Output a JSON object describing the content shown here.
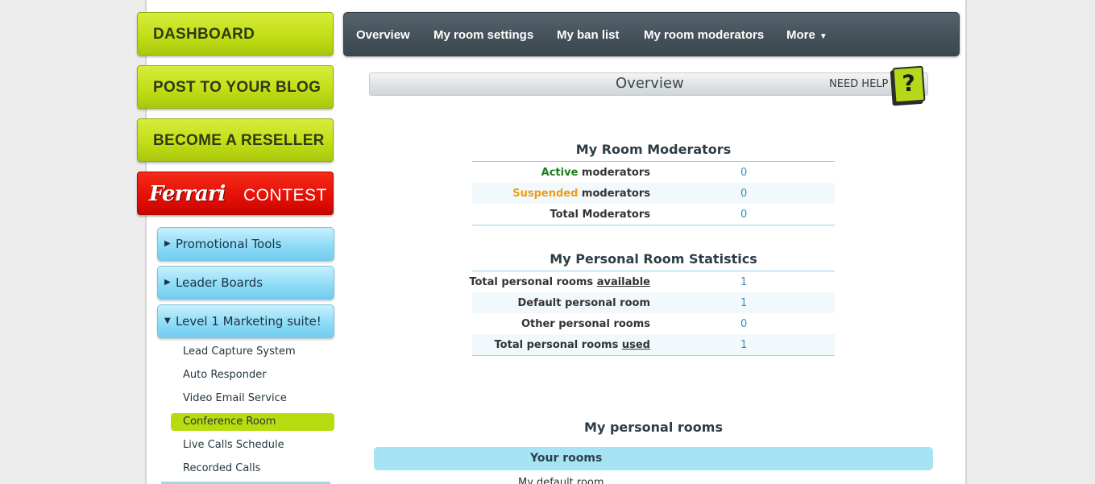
{
  "sidebar": {
    "dashboard_label": "DASHBOARD",
    "blog_label": "POST TO YOUR BLOG",
    "reseller_label": "BECOME A RESELLER",
    "ferrari_logo": "Ferrari",
    "contest_label": "CONTEST",
    "accordion": [
      {
        "label": "Promotional Tools",
        "expanded": false
      },
      {
        "label": "Leader Boards",
        "expanded": false
      },
      {
        "label": "Level 1 Marketing suite!",
        "expanded": true
      }
    ],
    "sub_items": [
      {
        "label": "Lead Capture System"
      },
      {
        "label": "Auto Responder"
      },
      {
        "label": "Video Email Service"
      },
      {
        "label": "Conference Room",
        "active": true
      },
      {
        "label": "Live Calls Schedule"
      },
      {
        "label": "Recorded Calls"
      }
    ]
  },
  "nav": {
    "items": [
      "Overview",
      "My room settings",
      "My ban list",
      "My room moderators",
      "More"
    ],
    "more_caret": "▼"
  },
  "overview": {
    "title": "Overview",
    "need_help": "NEED HELP",
    "help_icon": "?"
  },
  "moderators": {
    "title": "My Room Moderators",
    "active_word": "Active",
    "suspended_word": "Suspended",
    "moderators_word": "moderators",
    "active_value": "0",
    "suspended_value": "0",
    "total_label": "Total Moderators",
    "total_value": "0"
  },
  "stats": {
    "title": "My Personal Room Statistics",
    "available_prefix": "Total personal rooms",
    "available_word": "available",
    "available_value": "1",
    "default_label": "Default personal room",
    "default_value": "1",
    "other_label": "Other personal rooms",
    "other_value": "0",
    "used_prefix": "Total personal rooms",
    "used_word": "used",
    "used_value": "1"
  },
  "rooms": {
    "title": "My personal rooms",
    "header": "Your rooms",
    "first_row": "My default room"
  },
  "colors": {
    "green_button": "#c2de16",
    "ferrari_red": "#e40f05",
    "accordion_blue": "#8fdcf7",
    "nav_dark": "#46535b",
    "active_green": "#1f7a1f",
    "suspended_orange": "#f29b14",
    "value_blue": "#3a8fb8"
  }
}
